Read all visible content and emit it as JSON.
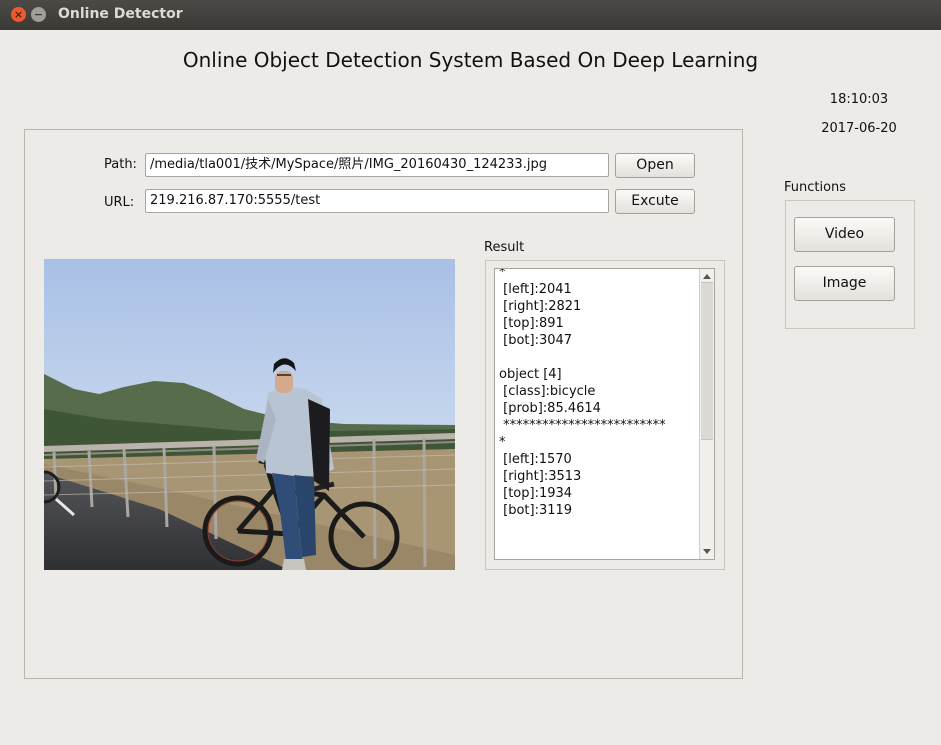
{
  "window": {
    "title": "Online Detector",
    "close_glyph": "×",
    "minimize_glyph": "−"
  },
  "header": {
    "title": "Online Object Detection System Based On Deep Learning",
    "time": "18:10:03",
    "date": "2017-06-20"
  },
  "form": {
    "path_label": "Path:",
    "path_value": "/media/tla001/技术/MySpace/照片/IMG_20160430_124233.jpg",
    "open_label": "Open",
    "url_label": "URL:",
    "url_value": "219.216.87.170:5555/test",
    "execute_label": "Excute"
  },
  "result": {
    "label": "Result",
    "text": "*\n [left]:2041\n [right]:2821\n [top]:891\n [bot]:3047\n\nobject [4]\n [class]:bicycle\n [prob]:85.4614\n *************************\n*\n [left]:1570\n [right]:3513\n [top]:1934\n [bot]:3119"
  },
  "functions": {
    "label": "Functions",
    "video_label": "Video",
    "image_label": "Image"
  },
  "colors": {
    "window_bg": "#edebe7",
    "titlebar": "#3c3b37",
    "close_button": "#e85c30"
  }
}
